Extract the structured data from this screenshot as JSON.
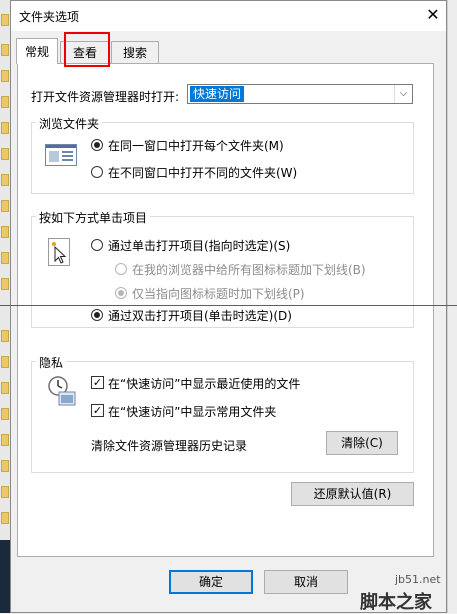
{
  "window": {
    "title": "文件夹选项",
    "close_glyph": "✕"
  },
  "tabs": [
    {
      "label": "常规",
      "active": true
    },
    {
      "label": "查看",
      "active": false
    },
    {
      "label": "搜索",
      "active": false
    }
  ],
  "open_explorer": {
    "label": "打开文件资源管理器时打开:",
    "value": "快速访问",
    "arrow": "⌵"
  },
  "browse": {
    "title": "浏览文件夹",
    "options": [
      {
        "label": "在同一窗口中打开每个文件夹(M)",
        "selected": true
      },
      {
        "label": "在不同窗口中打开不同的文件夹(W)",
        "selected": false
      }
    ]
  },
  "click": {
    "title": "按如下方式单击项目",
    "single": "通过单击打开项目(指向时选定)(S)",
    "sub1": "在我的浏览器中给所有图标标题加下划线(B)",
    "sub2": "仅当指向图标标题时加下划线(P)",
    "double": "通过双击打开项目(单击时选定)(D)"
  },
  "privacy": {
    "title": "隐私",
    "recent": "在“快速访问”中显示最近使用的文件",
    "frequent": "在“快速访问”中显示常用文件夹",
    "clear_label": "清除文件资源管理器历史记录",
    "clear_button": "清除(C)",
    "check_glyph": "✓"
  },
  "restore_button": "还原默认值(R)",
  "footer": {
    "ok": "确定",
    "cancel": "取消"
  },
  "watermark": {
    "site": "jb51.net",
    "name": "脚本之家"
  },
  "colors": {
    "highlight": "#ee0000",
    "accent": "#0078d7",
    "annotation_line": "#c83232"
  }
}
